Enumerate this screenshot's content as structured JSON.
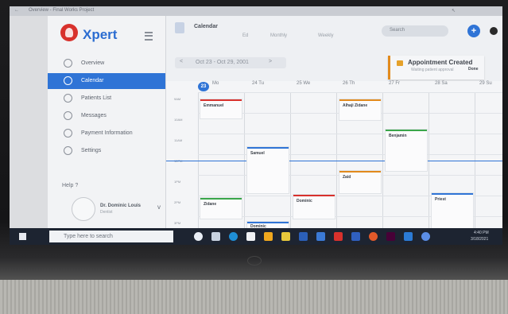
{
  "window": {
    "title": "Overview - Final Works Project"
  },
  "app": {
    "name": "Xpert"
  },
  "sidebar": {
    "items": [
      {
        "label": "Overview",
        "icon": "dashboard-icon",
        "active": false
      },
      {
        "label": "Calendar",
        "icon": "calendar-icon",
        "active": true
      },
      {
        "label": "Patients List",
        "icon": "list-icon",
        "active": false
      },
      {
        "label": "Messages",
        "icon": "chat-icon",
        "active": false
      },
      {
        "label": "Payment Information",
        "icon": "dollar-icon",
        "active": false
      },
      {
        "label": "Settings",
        "icon": "gear-icon",
        "active": false
      }
    ],
    "help": "Help ?",
    "user": {
      "name": "Dr. Dominic Louis",
      "role": "Dentist"
    }
  },
  "topbar": {
    "title": "Calendar",
    "tabs": [
      "Ed",
      "Monthly",
      "Weekly"
    ],
    "search_placeholder": "Search",
    "add_label": "+"
  },
  "calendar": {
    "range_label": "Oct 23 - Oct 29, 2001",
    "today_number": "23",
    "days": [
      {
        "num": "23",
        "name": "Mo"
      },
      {
        "num": "24",
        "name": "Tu"
      },
      {
        "num": "25",
        "name": "We"
      },
      {
        "num": "26",
        "name": "Th"
      },
      {
        "num": "27",
        "name": "Fr"
      },
      {
        "num": "28",
        "name": "Sa"
      },
      {
        "num": "29",
        "name": "Su"
      }
    ],
    "time_labels": [
      "9AM",
      "10AM",
      "11AM",
      "12PM",
      "1PM",
      "2PM",
      "3PM"
    ],
    "events": [
      {
        "name": "Emmanuel",
        "color": "#d8312c"
      },
      {
        "name": "Zidane",
        "color": "#3aa64a"
      },
      {
        "name": "Samuel",
        "color": "#2f74d6"
      },
      {
        "name": "Dominic",
        "color": "#2f74d6"
      },
      {
        "name": "Dominic",
        "color": "#d8312c"
      },
      {
        "name": "Alhaji Zidane",
        "color": "#e28a1c"
      },
      {
        "name": "Zaid",
        "color": "#e28a1c"
      },
      {
        "name": "Benjamin",
        "color": "#3aa64a"
      },
      {
        "name": "Priest",
        "color": "#2f74d6"
      }
    ]
  },
  "toast": {
    "title": "Appointment Created",
    "subtitle": "Waiting patient approval",
    "action": "Done"
  },
  "taskbar": {
    "search_placeholder": "Type here to search",
    "time": "4:40 PM",
    "date": "3/18/2021"
  },
  "colors": {
    "accent": "#2f74d6",
    "brand_red": "#d8312c",
    "warning": "#e28a1c",
    "success": "#3aa64a"
  }
}
